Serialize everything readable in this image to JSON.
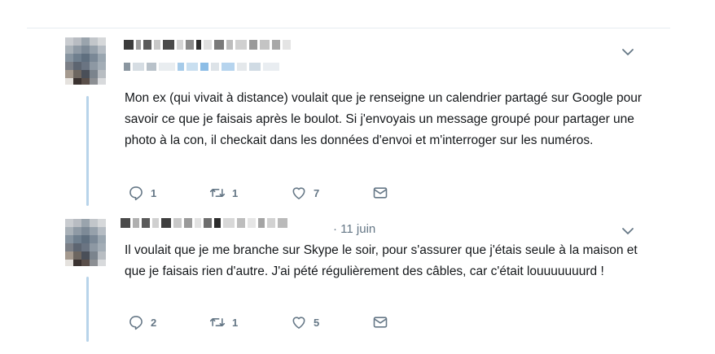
{
  "tweets": [
    {
      "text": "Mon ex (qui vivait à distance) voulait que je renseigne un calendrier partagé sur Google pour savoir ce que je faisais après le boulot. Si j'envoyais un message groupé pour partager une photo à la con, il checkait dans les données d'envoi et m'interroger sur les numéros.",
      "date": "",
      "replies": "1",
      "retweets": "1",
      "likes": "7"
    },
    {
      "text": "Il voulait que je me branche sur Skype le soir, pour s'assurer que j'étais seule à la maison et que je faisais rien d'autre. J'ai pété régulièrement des câbles, car c'était louuuuuuurd !",
      "date": "· 11 juin",
      "replies": "2",
      "retweets": "1",
      "likes": "5"
    }
  ],
  "icons": {
    "reply": "reply-icon",
    "retweet": "retweet-icon",
    "like": "heart-icon",
    "message": "message-icon",
    "menu": "chevron-down-icon"
  },
  "colors": {
    "icon": "#657786",
    "thread_line": "#b8d4ea",
    "text": "#14171a"
  }
}
